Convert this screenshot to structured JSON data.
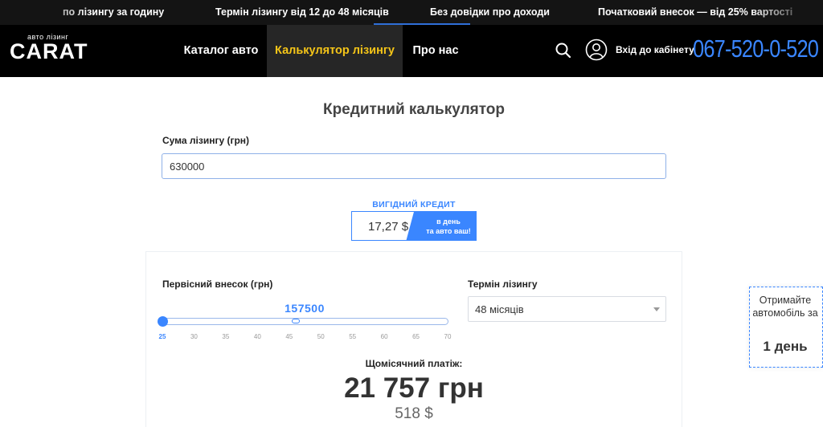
{
  "ticker": {
    "items": [
      "по лізингу за годину",
      "Термін лізингу від 12 до 48 місяців",
      "Без довідки про доходи",
      "Початковий внесок — від 25% вартості"
    ]
  },
  "header": {
    "logo_small": "авто лізинг",
    "logo_big": "CARAT",
    "nav": [
      "Каталог авто",
      "Калькулятор лізингу",
      "Про нас"
    ],
    "active_nav": "Калькулятор лізингу",
    "cabinet_label": "Вхід до кабінету",
    "phone": "067-520-0-520",
    "icons": {
      "search": "search-icon",
      "user": "user-icon"
    }
  },
  "calculator": {
    "title": "Кредитний калькулятор",
    "sum_label": "Сума лізингу (грн)",
    "sum_value": "630000",
    "promo": {
      "title": "ВИГІДНИЙ КРЕДИТ",
      "price": "17,27 $",
      "tag_line1": "в день",
      "tag_line2": "та авто ваш!"
    },
    "down_payment_label": "Первісний внесок (грн)",
    "down_payment_value": "157500",
    "slider": {
      "ticks": [
        "25",
        "30",
        "35",
        "40",
        "45",
        "50",
        "55",
        "60",
        "65",
        "70"
      ],
      "min": 25,
      "max": 70,
      "value": 25
    },
    "term_label": "Термін лізингу",
    "term_value": "48 місяців",
    "monthly_label": "Щомісячний платіж:",
    "monthly_value": "21 757 грн",
    "monthly_usd": "518 $"
  },
  "side_card": {
    "text": "Отримайте автомобіль за",
    "days": "1 день"
  },
  "colors": {
    "accent": "#3a86ff",
    "active_nav": "#f5c518",
    "header_bg": "#000000",
    "ticker_bg": "#141414"
  }
}
